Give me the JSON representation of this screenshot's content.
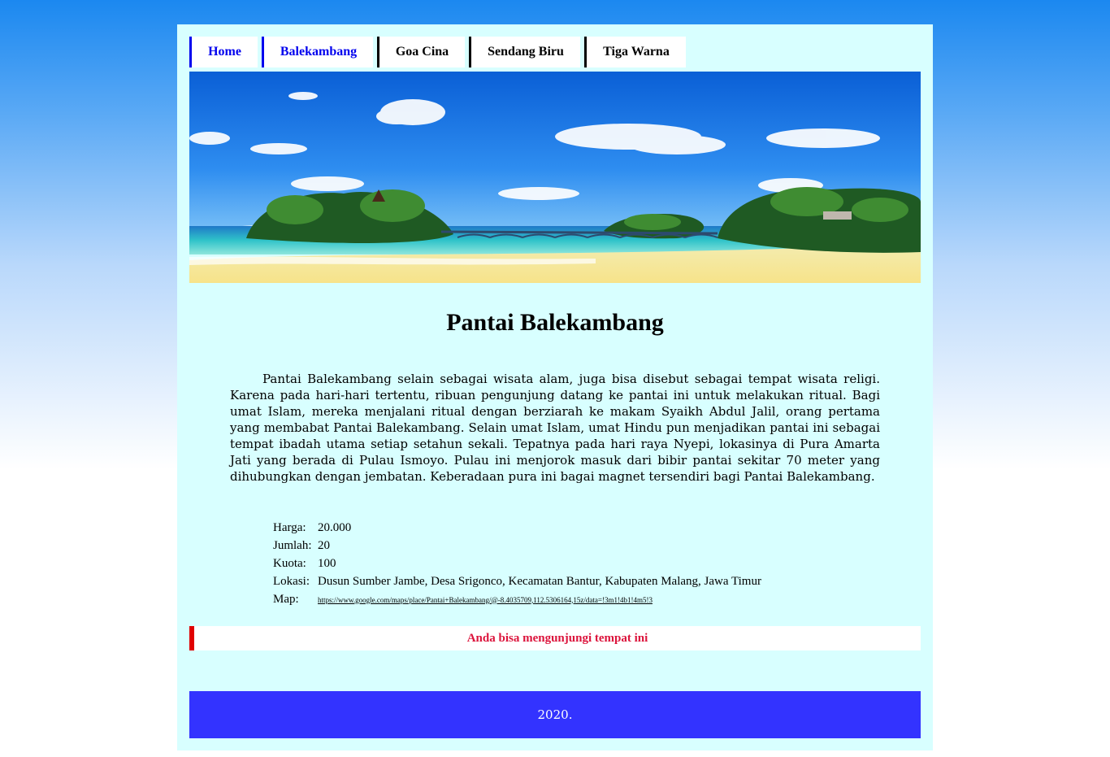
{
  "nav": {
    "items": [
      {
        "label": "Home"
      },
      {
        "label": "Balekambang"
      },
      {
        "label": "Goa Cina"
      },
      {
        "label": "Sendang Biru"
      },
      {
        "label": "Tiga Warna"
      }
    ]
  },
  "article": {
    "title": "Pantai Balekambang",
    "paragraph": "Pantai Balekambang selain sebagai wisata alam, juga bisa disebut sebagai tempat wisata religi. Karena pada hari-hari tertentu, ribuan pengunjung datang ke pantai ini untuk melakukan ritual. Bagi umat Islam, mereka menjalani ritual dengan berziarah ke makam Syaikh Abdul Jalil, orang pertama yang membabat Pantai Balekambang. Selain umat Islam, umat Hindu pun menjadikan pantai ini sebagai tempat ibadah utama setiap setahun sekali. Tepatnya pada hari raya Nyepi, lokasinya di Pura Amarta Jati yang berada di Pulau Ismoyo. Pulau ini menjorok masuk dari bibir pantai sekitar 70 meter yang dihubungkan dengan jembatan. Keberadaan pura ini bagai magnet tersendiri bagi Pantai Balekambang."
  },
  "info": {
    "harga_label": "Harga:",
    "harga_value": "20.000",
    "jumlah_label": "Jumlah:",
    "jumlah_value": "20",
    "kuota_label": "Kuota:",
    "kuota_value": "100",
    "lokasi_label": "Lokasi:",
    "lokasi_value": "Dusun Sumber Jambe, Desa Srigonco, Kecamatan Bantur, Kabupaten Malang, Jawa Timur",
    "map_label": "Map:",
    "map_value": "https://www.google.com/maps/place/Pantai+Balekambang/@-8.4035709,112.5306164,15z/data=!3m1!4b1!4m5!3"
  },
  "notice": {
    "text": "Anda bisa mengunjungi tempat ini"
  },
  "footer": {
    "text": "2020."
  },
  "colors": {
    "page_bg": "#d8ffff",
    "nav_active": "#0000ee",
    "notice_border": "#e00000",
    "notice_text": "#dc143c",
    "footer_bg": "#3333ff"
  }
}
